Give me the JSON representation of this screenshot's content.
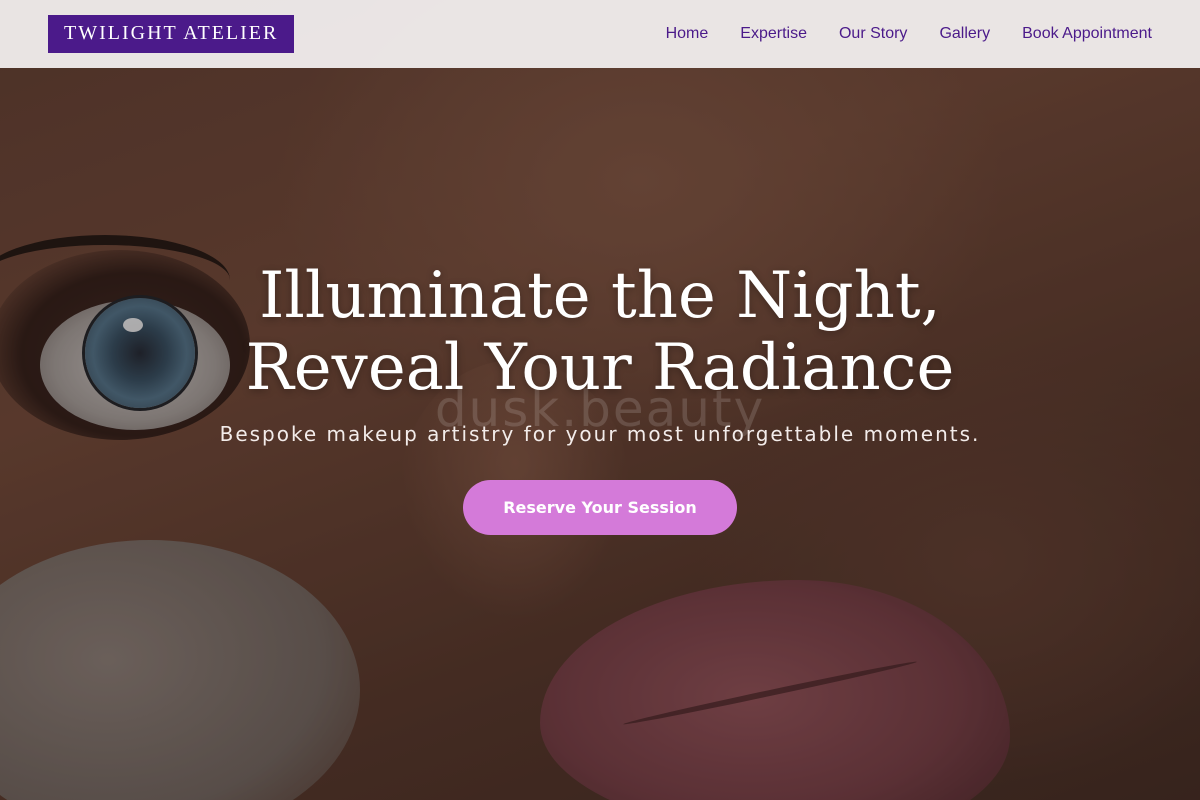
{
  "brand": {
    "logo_text": "TWILIGHT ATELIER"
  },
  "nav": {
    "items": [
      {
        "label": "Home"
      },
      {
        "label": "Expertise"
      },
      {
        "label": "Our Story"
      },
      {
        "label": "Gallery"
      },
      {
        "label": "Book Appointment"
      }
    ]
  },
  "hero": {
    "headline_line1": "Illuminate the Night,",
    "headline_line2": "Reveal Your Radiance",
    "subheadline": "Bespoke makeup artistry for your most unforgettable moments.",
    "cta_label": "Reserve Your Session",
    "watermark_text": "dusk.beauty"
  },
  "colors": {
    "brand_purple": "#4b1a8a",
    "cta_pink": "#d47ad9",
    "header_bg": "#f5f2f2"
  }
}
